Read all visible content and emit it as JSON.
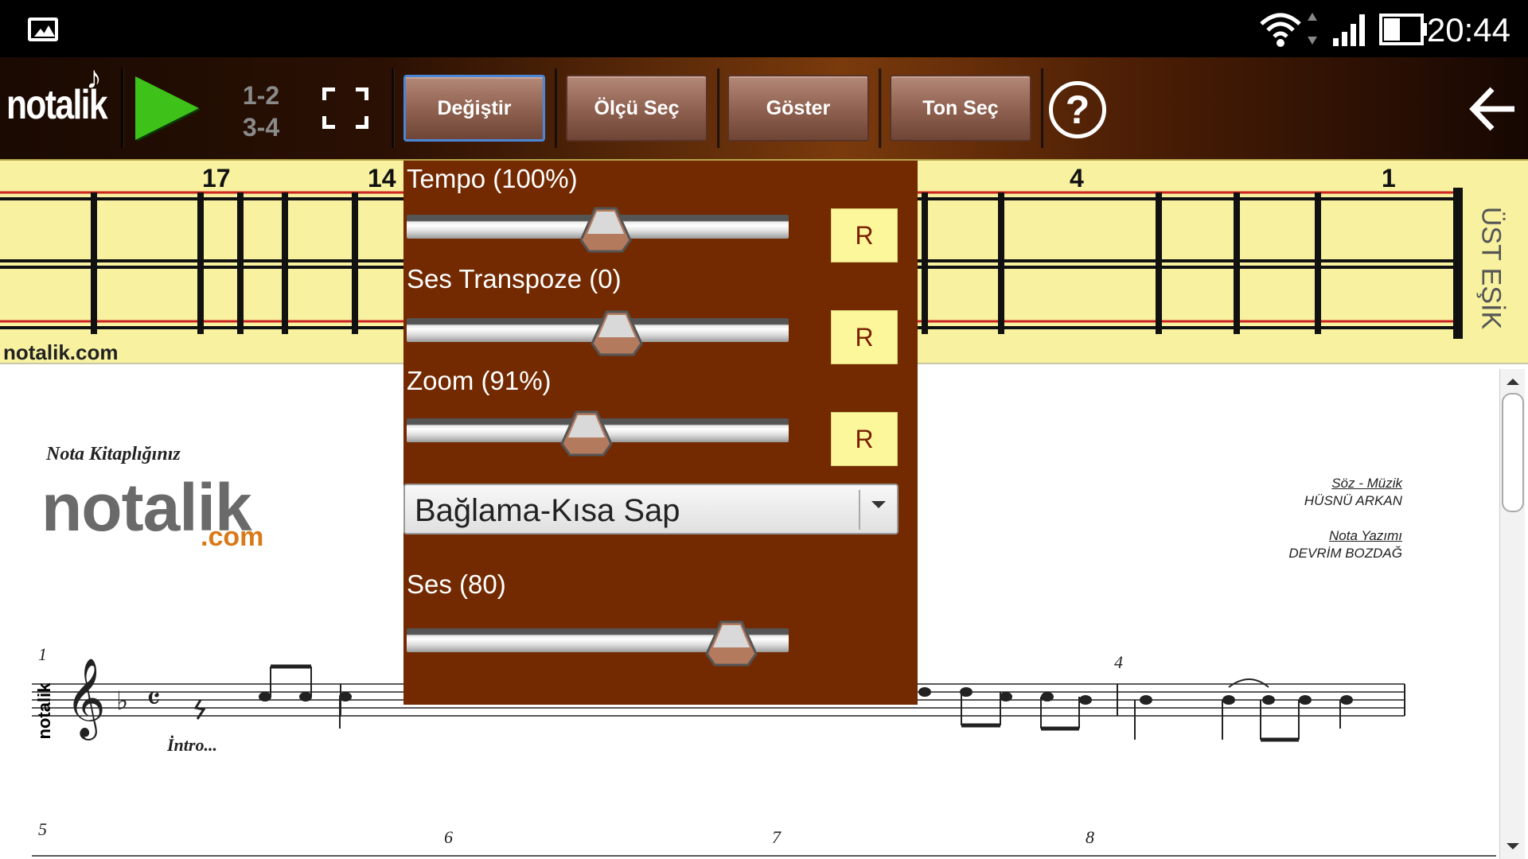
{
  "status_bar": {
    "time": "20:44",
    "icons": [
      "gallery-icon",
      "wifi-icon",
      "signal-icon",
      "battery-icon"
    ]
  },
  "toolbar": {
    "logo": "notalik",
    "measure_top": "1-2",
    "measure_bottom": "3-4",
    "buttons": [
      {
        "label": "Değiştir"
      },
      {
        "label": "Ölçü Seç"
      },
      {
        "label": "Göster"
      },
      {
        "label": "Ton Seç"
      }
    ],
    "help_label": "?"
  },
  "fretboard": {
    "fret_numbers": [
      "17",
      "14",
      "4",
      "1"
    ],
    "site_label": "notalik.com",
    "nut_label": "ÜST EŞİK"
  },
  "settings_panel": {
    "tempo": {
      "label": "Tempo (100%)",
      "level_fraction": 0.52,
      "reset_label": "R"
    },
    "transpose": {
      "label": "Ses Transpoze (0)",
      "level_fraction": 0.55,
      "reset_label": "R"
    },
    "zoom": {
      "label": "Zoom (91%)",
      "level_fraction": 0.47,
      "reset_label": "R"
    },
    "instrument": {
      "selected": "Bağlama-Kısa Sap"
    },
    "volume": {
      "label": "Ses (80)",
      "level_fraction": 0.85
    }
  },
  "sheet": {
    "brand_tagline": "Nota Kitaplığınız",
    "brand_logo": "notalik",
    "brand_com": ".com",
    "credit_heading_1": "Söz - Müzik",
    "credit_name_1": "HÜSNÜ ARKAN",
    "credit_heading_2": "Nota Yazımı",
    "credit_name_2": "DEVRİM BOZDAĞ",
    "intro_text": "İntro...",
    "vertical_brand": "notalik",
    "bar_numbers_row1": [
      "1",
      "4"
    ],
    "bar_numbers_row2": [
      "5",
      "6",
      "7",
      "8"
    ]
  }
}
